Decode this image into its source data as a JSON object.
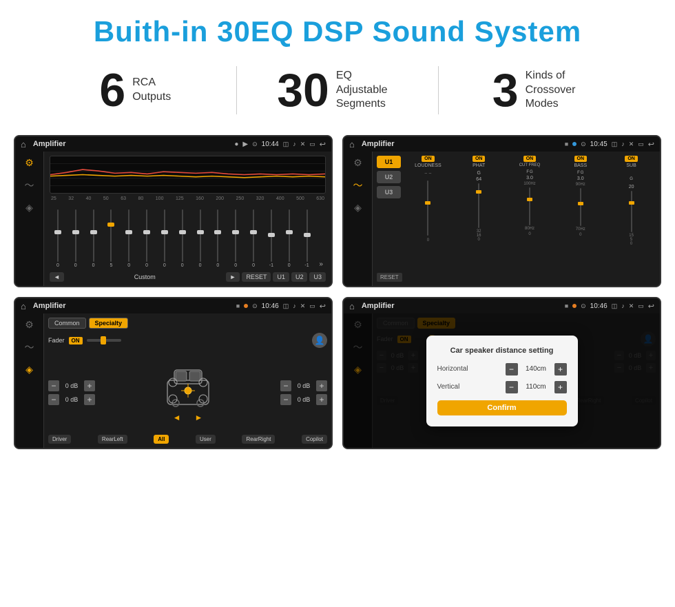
{
  "header": {
    "title": "Buith-in 30EQ DSP Sound System"
  },
  "stats": [
    {
      "number": "6",
      "label": "RCA\nOutputs"
    },
    {
      "number": "30",
      "label": "EQ Adjustable\nSegments"
    },
    {
      "number": "3",
      "label": "Kinds of\nCrossover Modes"
    }
  ],
  "screens": [
    {
      "id": "screen-eq",
      "app": "Amplifier",
      "time": "10:44",
      "type": "eq"
    },
    {
      "id": "screen-xover",
      "app": "Amplifier",
      "time": "10:45",
      "type": "crossover"
    },
    {
      "id": "screen-fader",
      "app": "Amplifier",
      "time": "10:46",
      "type": "fader"
    },
    {
      "id": "screen-dialog",
      "app": "Amplifier",
      "time": "10:46",
      "type": "fader-dialog",
      "dialog": {
        "title": "Car speaker distance setting",
        "horizontal_label": "Horizontal",
        "horizontal_value": "140cm",
        "vertical_label": "Vertical",
        "vertical_value": "110cm",
        "confirm_label": "Confirm"
      }
    }
  ],
  "eq": {
    "frequencies": [
      "25",
      "32",
      "40",
      "50",
      "63",
      "80",
      "100",
      "125",
      "160",
      "200",
      "250",
      "320",
      "400",
      "500",
      "630"
    ],
    "values": [
      "0",
      "0",
      "0",
      "5",
      "0",
      "0",
      "0",
      "0",
      "0",
      "0",
      "0",
      "0",
      "-1",
      "0",
      "-1"
    ],
    "mode": "Custom",
    "buttons": [
      "RESET",
      "U1",
      "U2",
      "U3"
    ]
  },
  "crossover": {
    "u_buttons": [
      "U1",
      "U2",
      "U3"
    ],
    "channels": [
      "LOUDNESS",
      "PHAT",
      "CUT FREQ",
      "BASS",
      "SUB"
    ],
    "on_label": "ON"
  },
  "fader": {
    "tabs": [
      "Common",
      "Specialty"
    ],
    "active_tab": "Specialty",
    "fader_label": "Fader",
    "on_label": "ON",
    "gains": [
      "0 dB",
      "0 dB",
      "0 dB",
      "0 dB"
    ],
    "bottom_buttons": [
      "Driver",
      "Copilot",
      "RearLeft",
      "All",
      "User",
      "RearRight"
    ]
  },
  "dialog": {
    "title": "Car speaker distance setting",
    "horizontal_label": "Horizontal",
    "horizontal_value": "140cm",
    "vertical_label": "Vertical",
    "vertical_value": "110cm",
    "confirm_label": "Confirm"
  }
}
